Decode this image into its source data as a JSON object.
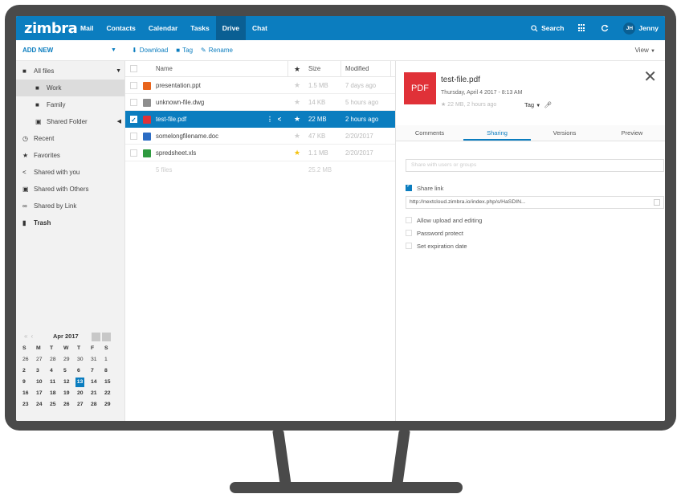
{
  "topbar": {
    "logo": "zimbra",
    "tabs": [
      {
        "label": "Mail"
      },
      {
        "label": "Contacts"
      },
      {
        "label": "Calendar"
      },
      {
        "label": "Tasks"
      },
      {
        "label": "Drive",
        "active": true
      },
      {
        "label": "Chat"
      }
    ],
    "search_label": "Search",
    "user_initials": "JH",
    "user_name": "Jenny"
  },
  "toolbar": {
    "add_new": "ADD NEW",
    "download": "Download",
    "tag": "Tag",
    "rename": "Rename",
    "view": "View"
  },
  "sidebar": {
    "items": [
      {
        "label": "All files",
        "icon": "folder-icon"
      },
      {
        "label": "Work",
        "icon": "folder-icon"
      },
      {
        "label": "Family",
        "icon": "folder-icon"
      },
      {
        "label": "Shared Folder",
        "icon": "shared-folder-icon"
      },
      {
        "label": "Recent",
        "icon": "clock-icon"
      },
      {
        "label": "Favorites",
        "icon": "star-icon"
      },
      {
        "label": "Shared with you",
        "icon": "share-icon"
      },
      {
        "label": "Shared with Others",
        "icon": "shared-folder-icon"
      },
      {
        "label": "Shared by Link",
        "icon": "link-icon"
      },
      {
        "label": "Trash",
        "icon": "trash-icon"
      }
    ]
  },
  "calendar": {
    "month": "Apr 2017",
    "dow": [
      "S",
      "M",
      "T",
      "W",
      "T",
      "F",
      "S"
    ],
    "weeks": [
      [
        "26",
        "27",
        "28",
        "29",
        "30",
        "31",
        "1"
      ],
      [
        "2",
        "3",
        "4",
        "5",
        "6",
        "7",
        "8"
      ],
      [
        "9",
        "10",
        "11",
        "12",
        "13",
        "14",
        "15"
      ],
      [
        "16",
        "17",
        "18",
        "19",
        "20",
        "21",
        "22"
      ],
      [
        "23",
        "24",
        "25",
        "26",
        "27",
        "28",
        "29"
      ]
    ],
    "today": "13"
  },
  "filelist": {
    "columns": {
      "name": "Name",
      "size": "Size",
      "modified": "Modified"
    },
    "rows": [
      {
        "name": "presentation.ppt",
        "size": "1.5 MB",
        "modified": "7 days ago",
        "color": "#e8641c",
        "starred": false
      },
      {
        "name": "unknown-file.dwg",
        "size": "14 KB",
        "modified": "5 hours ago",
        "color": "#8e8e8e",
        "starred": false
      },
      {
        "name": "test-file.pdf",
        "size": "22 MB",
        "modified": "2 hours ago",
        "color": "#e03138",
        "starred": false,
        "selected": true
      },
      {
        "name": "somelongfilename.doc",
        "size": "47 KB",
        "modified": "2/20/2017",
        "color": "#2b6cc4",
        "starred": false
      },
      {
        "name": "spredsheet.xls",
        "size": "1.1 MB",
        "modified": "2/20/2017",
        "color": "#2e9a3f",
        "starred": true
      }
    ],
    "summary_count": "5 files",
    "summary_size": "25.2 MB"
  },
  "details": {
    "badge": "PDF",
    "title": "test-file.pdf",
    "date": "Thursday, April 4 2017 - 8:13 AM",
    "meta": "22 MB, 2 hours ago",
    "tag": "Tag",
    "tabs": [
      "Comments",
      "Sharing",
      "Versions",
      "Preview"
    ],
    "share_placeholder": "Share with users or groups",
    "share_link_label": "Share link",
    "link_value": "http://nextcloud.zimbra.io/index.php/s/HaSDIN...",
    "options": [
      "Allow upload and editing",
      "Password protect",
      "Set expiration date"
    ]
  },
  "colors": {
    "accent": "#0b7dbf",
    "pdf": "#e03138",
    "starred": "#f4c20d"
  }
}
